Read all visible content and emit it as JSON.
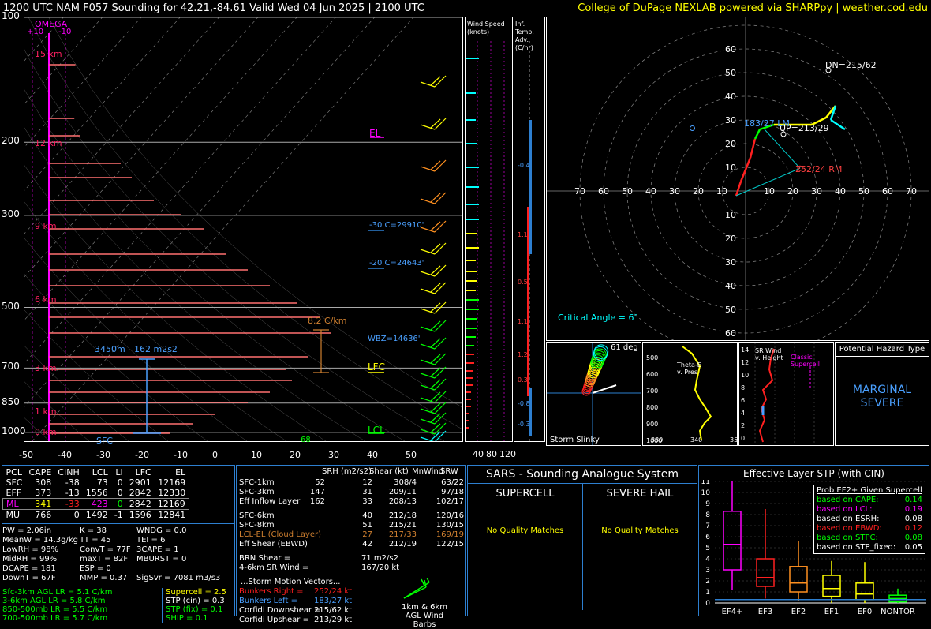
{
  "header": {
    "title": "1200 UTC NAM F057 Sounding for 42.21,-84.61 Valid  Wed 04 Jun 2025 | 2100 UTC",
    "credit": "College of DuPage NEXLAB powered via SHARPpy | weather.cod.edu"
  },
  "skewt": {
    "pressure_ticks": [
      "100",
      "200",
      "300",
      "500",
      "700",
      "850",
      "1000"
    ],
    "temp_ticks": [
      "-50",
      "-40",
      "-30",
      "-20",
      "-10",
      "0",
      "10",
      "20",
      "30",
      "40",
      "50"
    ],
    "omega_label": "OMEGA",
    "omega_scale": [
      "+10",
      "-10"
    ],
    "height_labels": [
      "15 km",
      "12 km",
      "9 km",
      "6 km",
      "3 km",
      "1 km",
      "0 km"
    ],
    "annotations": {
      "el": "EL",
      "lfc": "LFC",
      "lcl": "LCL",
      "minus30": "-30 C=29910'",
      "minus20": "-20 C=24643'",
      "wetbulb": "WBZ=14636'",
      "lapse": "8.2 C/km",
      "effective_depth": "3450m",
      "effective_srh": "162 m2s2",
      "sfc": "SFC",
      "sfc_td": "68"
    },
    "colors": {
      "temperature": "#d40000",
      "dewpoint": "#00cc00",
      "wetbulb": "#00ffff",
      "parcel": "#2d7fd0",
      "virtual": "#cc0000"
    }
  },
  "wind_speed_panel": {
    "label": "Wind Speed (knots)",
    "ticks": [
      "40",
      "80",
      "120"
    ]
  },
  "inferred_panel": {
    "label": "Inf. Temp. Adv. (C/hr)",
    "values": [
      "-0.4",
      "1.1",
      "0.5",
      "1.1",
      "1.2",
      "0.3",
      "-0.8",
      "-0.3"
    ]
  },
  "hodograph": {
    "rings": [
      "10",
      "20",
      "30",
      "40",
      "50",
      "60"
    ],
    "x_ticks": [
      "70",
      "60",
      "50",
      "40",
      "30",
      "20",
      "10",
      "10",
      "20",
      "30",
      "40",
      "50",
      "60",
      "70"
    ],
    "labels": {
      "dn": "DN=215/62",
      "up": "UP=213/29",
      "left_mover": "183/27 LM",
      "right_mover": "252/24 RM",
      "critical_angle": "Critical Angle = 6°"
    }
  },
  "small_panels": {
    "slinky": {
      "label": "Storm Slinky",
      "deg": "61 deg"
    },
    "theta": {
      "label": "Theta-E v. Pres",
      "pressure_ticks": [
        "500",
        "600",
        "700",
        "800",
        "900",
        "1000"
      ],
      "x_ticks": [
        "330",
        "340",
        "35"
      ]
    },
    "srwind": {
      "label": "SR Wind v. Height",
      "ticks": [
        "14",
        "12",
        "10",
        "8",
        "6",
        "4",
        "2",
        "0"
      ],
      "classic": "Classic Supercell"
    },
    "hazard": {
      "title": "Potential Hazard Type",
      "value": "MARGINAL SEVERE"
    }
  },
  "parcel_table": {
    "headers": [
      "PCL",
      "CAPE",
      "CINH",
      "LCL",
      "LI",
      "LFC",
      "EL"
    ],
    "rows": [
      [
        "SFC",
        "308",
        "-38",
        "73",
        "0",
        "2901",
        "12169"
      ],
      [
        "EFF",
        "373",
        "-13",
        "1556",
        "0",
        "2842",
        "12330"
      ],
      [
        "ML",
        "341",
        "-33",
        "423",
        "0",
        "2842",
        "12169"
      ],
      [
        "MU",
        "766",
        "0",
        "1492",
        "-1",
        "1596",
        "12841"
      ]
    ],
    "indices": [
      [
        "PW = 2.06in",
        "K = 38",
        "WNDG = 0.0"
      ],
      [
        "MeanW = 14.3g/kg",
        "TT = 45",
        "TEI = 6"
      ],
      [
        "LowRH = 98%",
        "ConvT = 77F",
        "3CAPE = 1"
      ],
      [
        "MidRH = 99%",
        "maxT = 82F",
        "MBURST = 0"
      ],
      [
        "DCAPE = 181",
        "ESP = 0",
        ""
      ],
      [
        "DownT = 67F",
        "MMP = 0.37",
        "SigSvr = 7081 m3/s3"
      ]
    ],
    "lapse_rates": [
      "Sfc-3km AGL LR = 5.1 C/km",
      "3-6km AGL LR = 5.8 C/km",
      "850-500mb LR = 5.5 C/km",
      "700-500mb LR = 5.7 C/km"
    ],
    "composites": [
      "Supercell = 2.5",
      "STP (cin) = 0.3",
      "STP (fix) = 0.1",
      "SHIP = 0.1"
    ]
  },
  "kinematics": {
    "headers": [
      "SRH (m2/s2)",
      "Shear (kt)",
      "MnWind",
      "SRW"
    ],
    "rows": [
      [
        "SFC-1km",
        "52",
        "12",
        "308/4",
        "63/22"
      ],
      [
        "SFC-3km",
        "147",
        "31",
        "209/11",
        "97/18"
      ],
      [
        "Eff Inflow Layer",
        "162",
        "33",
        "208/13",
        "102/17"
      ],
      [
        "SFC-6km",
        "40",
        "212/18",
        "120/16"
      ],
      [
        "SFC-8km",
        "51",
        "215/21",
        "130/15"
      ],
      [
        "LCL-EL (Cloud Layer)",
        "27",
        "217/33",
        "169/19"
      ],
      [
        "Eff Shear (EBWD)",
        "42",
        "212/19",
        "122/15"
      ]
    ],
    "brn": [
      "BRN Shear =",
      "71 m2/s2"
    ],
    "sr_wind": [
      "4-6km SR Wind =",
      "167/20 kt"
    ],
    "storm_motion_title": "...Storm Motion Vectors...",
    "motions": [
      [
        "Bunkers Right =",
        "252/24 kt"
      ],
      [
        "Bunkers Left =",
        "183/27 kt"
      ],
      [
        "Corfidi Downshear =",
        "215/62 kt"
      ],
      [
        "Corfidi Upshear =",
        "213/29 kt"
      ]
    ],
    "barb_label": "1km & 6km AGL Wind Barbs"
  },
  "sars": {
    "title": "SARS - Sounding Analogue System",
    "supercell": "SUPERCELL",
    "hail": "SEVERE HAIL",
    "no_match": "No Quality Matches"
  },
  "stp": {
    "title": "Effective Layer STP (with CIN)",
    "legend_title": "Prob EF2+ Given Supercell",
    "legend": [
      [
        "based on CAPE:",
        "0.14",
        "#00ff00"
      ],
      [
        "based on LCL:",
        "0.19",
        "#ff00ff"
      ],
      [
        "based on ESRH:",
        "0.08",
        "#ffffff"
      ],
      [
        "based on EBWD:",
        "0.12",
        "#ff2020"
      ],
      [
        "based on STPC:",
        "0.08",
        "#00ff00"
      ],
      [
        "based on STP_fixed:",
        "0.05",
        "#ffffff"
      ]
    ],
    "y_ticks": [
      "11",
      "10",
      "9",
      "8",
      "7",
      "6",
      "5",
      "4",
      "3",
      "2",
      "1",
      "0"
    ],
    "categories": [
      "EF4+",
      "EF3",
      "EF2",
      "EF1",
      "EF0",
      "NONTOR"
    ],
    "colors": [
      "#ff00ff",
      "#ff2020",
      "#ff9020",
      "#ffff00",
      "#ffff00",
      "#00ff00"
    ]
  },
  "chart_data": {
    "type": "box",
    "categories": [
      "EF4+",
      "EF3",
      "EF2",
      "EF1",
      "EF0",
      "NONTOR"
    ],
    "series": [
      {
        "values": [
          {
            "whisker_low": 1.2,
            "q1": 3.0,
            "median": 5.3,
            "q3": 8.3,
            "whisker_high": 11.0
          },
          {
            "whisker_low": 0.4,
            "q1": 1.5,
            "median": 2.3,
            "q3": 4.0,
            "whisker_high": 8.5
          },
          {
            "whisker_low": 0.2,
            "q1": 1.0,
            "median": 1.8,
            "q3": 3.3,
            "whisker_high": 5.6
          },
          {
            "whisker_low": 0.0,
            "q1": 0.6,
            "median": 1.3,
            "q3": 2.5,
            "whisker_high": 3.8
          },
          {
            "whisker_low": 0.0,
            "q1": 0.3,
            "median": 0.8,
            "q3": 1.8,
            "whisker_high": 3.7
          },
          {
            "whisker_low": 0.0,
            "q1": 0.1,
            "median": 0.4,
            "q3": 0.7,
            "whisker_high": 1.3
          }
        ]
      }
    ],
    "ylim": [
      0,
      11
    ],
    "grid": true
  }
}
